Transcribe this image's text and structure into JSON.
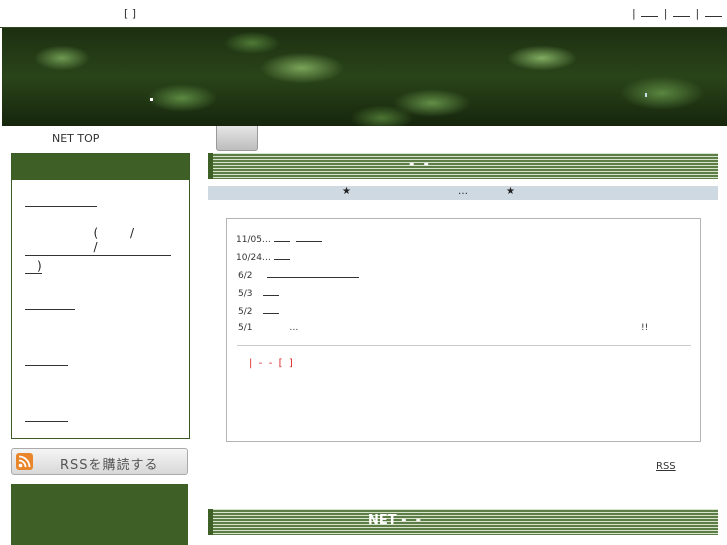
{
  "header": {
    "left_bracket": "[ ]",
    "right_links_sep": "|"
  },
  "nav": {
    "top_label": "NET TOP"
  },
  "sidebar": {
    "paren_text": "( / /",
    "paren_close": ")",
    "rss_button_label": "RSSを購読する"
  },
  "main": {
    "section1_title": "-  -",
    "subbar_star_left": "★",
    "subbar_ellipsis": "…",
    "subbar_star_right": "★",
    "news": [
      {
        "date": "11/05…"
      },
      {
        "date": "10/24…"
      },
      {
        "date": "6/2"
      },
      {
        "date": "5/3"
      },
      {
        "date": "5/2"
      },
      {
        "date": "5/1",
        "text": "…",
        "tail": "!!"
      }
    ],
    "red_text": "|  -  -  [  ]",
    "rss_link": "RSS",
    "section2_title": "NET -  -"
  },
  "colors": {
    "accent_green": "#3e5f26",
    "red_text": "#dd2222",
    "subbar": "#cfd9e1"
  }
}
